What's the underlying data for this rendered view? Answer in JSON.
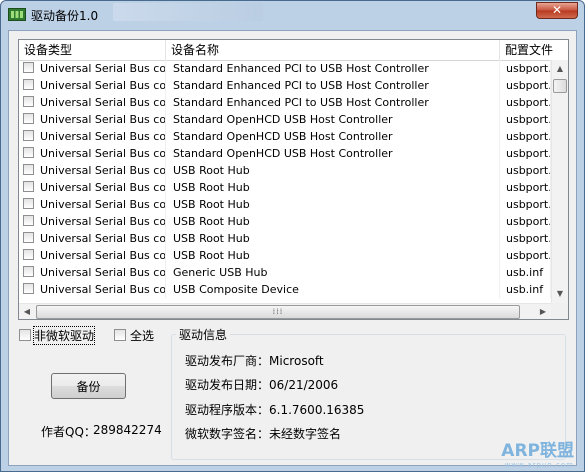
{
  "window": {
    "title": "驱动备份1.0",
    "close_label": "✕"
  },
  "list": {
    "columns": [
      "设备类型",
      "设备名称",
      "配置文件"
    ],
    "rows": [
      [
        "Universal Serial Bus con...",
        "Standard Enhanced PCI to USB Host Controller",
        "usbport.inf"
      ],
      [
        "Universal Serial Bus con...",
        "Standard Enhanced PCI to USB Host Controller",
        "usbport.inf"
      ],
      [
        "Universal Serial Bus con...",
        "Standard Enhanced PCI to USB Host Controller",
        "usbport.inf"
      ],
      [
        "Universal Serial Bus con...",
        "Standard OpenHCD USB Host Controller",
        "usbport.inf"
      ],
      [
        "Universal Serial Bus con...",
        "Standard OpenHCD USB Host Controller",
        "usbport.inf"
      ],
      [
        "Universal Serial Bus con...",
        "Standard OpenHCD USB Host Controller",
        "usbport.inf"
      ],
      [
        "Universal Serial Bus con...",
        "USB Root Hub",
        "usbport.inf"
      ],
      [
        "Universal Serial Bus con...",
        "USB Root Hub",
        "usbport.inf"
      ],
      [
        "Universal Serial Bus con...",
        "USB Root Hub",
        "usbport.inf"
      ],
      [
        "Universal Serial Bus con...",
        "USB Root Hub",
        "usbport.inf"
      ],
      [
        "Universal Serial Bus con...",
        "USB Root Hub",
        "usbport.inf"
      ],
      [
        "Universal Serial Bus con...",
        "USB Root Hub",
        "usbport.inf"
      ],
      [
        "Universal Serial Bus con...",
        "Generic USB Hub",
        "usb.inf"
      ],
      [
        "Universal Serial Bus con...",
        "USB Composite Device",
        "usb.inf"
      ]
    ]
  },
  "controls": {
    "non_ms_label": "非微软驱动",
    "select_all_label": "全选",
    "backup_label": "备份",
    "author_label": "作者QQ：",
    "author_qq": "289842274"
  },
  "info": {
    "title": "驱动信息",
    "publisher_label": "驱动发布厂商：",
    "publisher": "Microsoft",
    "date_label": "驱动发布日期：",
    "date": "06/21/2006",
    "version_label": "驱动程序版本：",
    "version": "6.1.7600.16385",
    "signature_label": "微软数字签名：",
    "signature": "未经数字签名"
  },
  "watermark": {
    "main": "ARP联盟",
    "sub": "www.arpun.com"
  },
  "colors": {
    "title_bar": "#bcd0e6",
    "close_button": "#c7533c",
    "client_bg": "#f0f0f0"
  }
}
